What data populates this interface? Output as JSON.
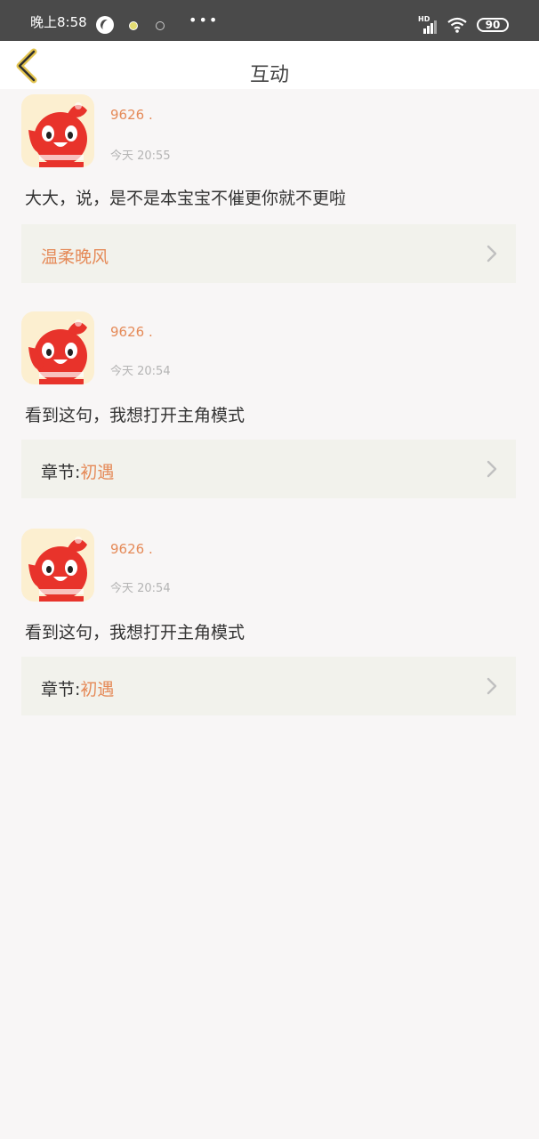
{
  "status_bar": {
    "time": "晚上8:58",
    "battery": "90",
    "network_label": "HD",
    "more": "•••"
  },
  "header": {
    "title": "互动"
  },
  "comments": [
    {
      "user": "9626 .",
      "time": "今天 20:55",
      "text": "大大，说，是不是本宝宝不催更你就不更啦",
      "link_prefix": "",
      "link_value": "温柔晚风"
    },
    {
      "user": "9626 .",
      "time": "今天 20:54",
      "text": "看到这句，我想打开主角模式",
      "link_prefix": "章节:",
      "link_value": "初遇"
    },
    {
      "user": "9626 .",
      "time": "今天 20:54",
      "text": "看到这句，我想打开主角模式",
      "link_prefix": "章节:",
      "link_value": "初遇"
    }
  ],
  "colors": {
    "accent": "#e58a58",
    "back_arrow": "#e3c44e",
    "avatar_red": "#e8332b"
  },
  "icons": {
    "back": "chevron-left-icon",
    "row_arrow": "chevron-right-icon",
    "avatar": "mascot-avatar-icon"
  }
}
